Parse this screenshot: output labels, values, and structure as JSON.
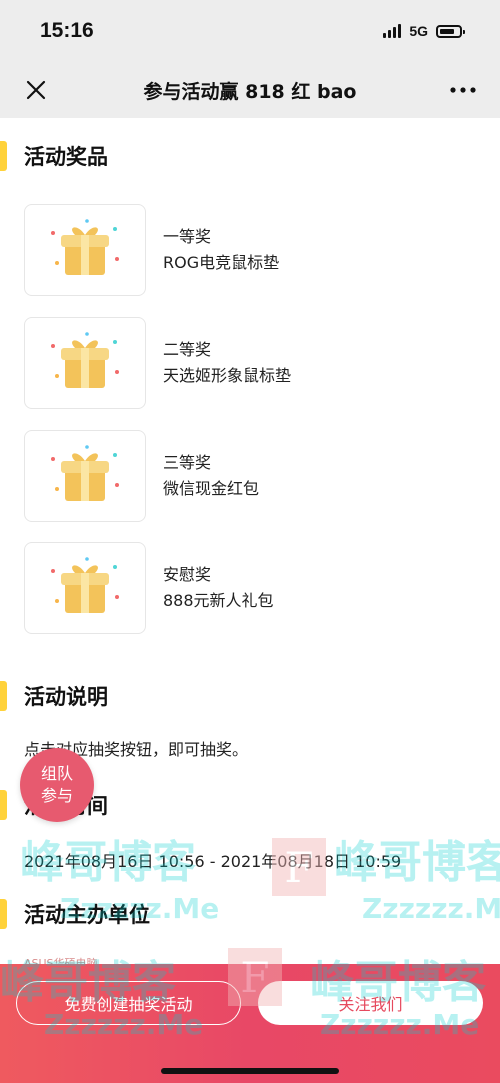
{
  "status": {
    "time": "15:16",
    "network": "5G"
  },
  "nav": {
    "title": "参与活动赢 818 红 bao"
  },
  "sections": {
    "prizes": "活动奖品",
    "description": "活动说明",
    "time": "活动时间",
    "organizer": "活动主办单位"
  },
  "prizes": [
    {
      "level": "一等奖",
      "name": "ROG电竞鼠标垫"
    },
    {
      "level": "二等奖",
      "name": "天选姬形象鼠标垫"
    },
    {
      "level": "三等奖",
      "name": "微信现金红包"
    },
    {
      "level": "安慰奖",
      "name": "888元新人礼包"
    }
  ],
  "description_text": "点击对应抽奖按钮，即可抽奖。",
  "time_range": "2021年08月16日 10:56 - 2021年08月18日 10:59",
  "organizer_text": "ASUS华硕电脑",
  "team_button": {
    "line1": "组队",
    "line2": "参与"
  },
  "bottom": {
    "create_label": "免费创建抽奖活动",
    "follow_label": "关注我们"
  },
  "watermark": {
    "brand": "峰哥博客",
    "domain": "Zzzzzz.Me",
    "logo_letter": "F"
  },
  "colors": {
    "accent": "#ffd23b",
    "primary": "#e84866",
    "watermark": "#00cfd0"
  }
}
